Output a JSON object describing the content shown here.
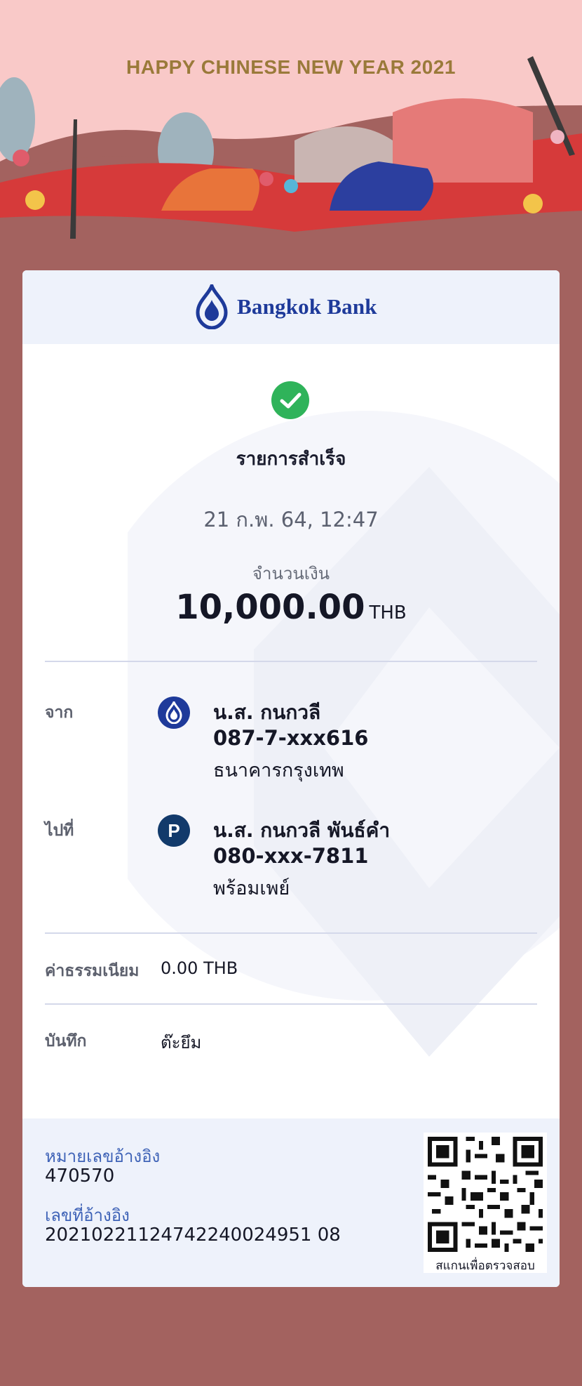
{
  "banner": {
    "title": "HAPPY CHINESE NEW YEAR 2021"
  },
  "bank": {
    "name": "Bangkok Bank",
    "brand_color": "#1e3a9a"
  },
  "status": {
    "text": "รายการสำเร็จ",
    "color": "#2fb35a"
  },
  "datetime": "21 ก.พ. 64, 12:47",
  "amount": {
    "label": "จำนวนเงิน",
    "value": "10,000.00",
    "currency": "THB"
  },
  "from": {
    "label": "จาก",
    "name": "น.ส. กนกวลี",
    "account": "087-7-xxx616",
    "bank": "ธนาคารกรุงเทพ",
    "icon": "bangkok-bank-logo-icon"
  },
  "to": {
    "label": "ไปที่",
    "name": "น.ส. กนกวลี พันธ์คำ",
    "account": "080-xxx-7811",
    "bank": "พร้อมเพย์",
    "icon": "promptpay-icon",
    "icon_letter": "P"
  },
  "fee": {
    "label": "ค่าธรรมเนียม",
    "value": "0.00 THB"
  },
  "memo": {
    "label": "บันทึก",
    "value": "ต๊ะยึม"
  },
  "reference": {
    "ref_label": "หมายเลขอ้างอิง",
    "ref_value": "470570",
    "no_label": "เลขที่อ้างอิง",
    "no_value": "20210221124742240024951 08"
  },
  "qr": {
    "caption": "สแกนเพื่อตรวจสอบ"
  }
}
